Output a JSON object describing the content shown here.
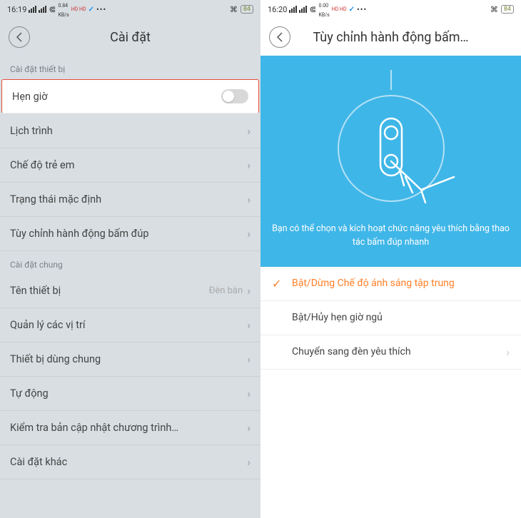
{
  "left": {
    "status": {
      "time": "16:19",
      "speed1": "0.84",
      "speed2": "KB/s",
      "battery": "84"
    },
    "header": {
      "title": "Cài đặt"
    },
    "section1": {
      "label": "Cài đặt thiết bị"
    },
    "rows1": [
      {
        "label": "Hẹn giờ",
        "type": "toggle",
        "highlight": true
      },
      {
        "label": "Lịch trình",
        "type": "chevron"
      },
      {
        "label": "Chế độ trẻ em",
        "type": "chevron"
      },
      {
        "label": "Trạng thái mặc định",
        "type": "chevron"
      },
      {
        "label": "Tùy chỉnh hành động bấm đúp",
        "type": "chevron"
      }
    ],
    "section2": {
      "label": "Cài đặt chung"
    },
    "rows2": [
      {
        "label": "Tên thiết bị",
        "value": "Đèn bàn",
        "type": "chevron"
      },
      {
        "label": "Quản lý các vị trí",
        "type": "chevron"
      },
      {
        "label": "Thiết bị dùng chung",
        "type": "chevron"
      },
      {
        "label": "Tự động",
        "type": "chevron"
      },
      {
        "label": "Kiểm tra bản cập nhật chương trình…",
        "type": "chevron"
      },
      {
        "label": "Cài đặt khác",
        "type": "chevron"
      }
    ]
  },
  "right": {
    "status": {
      "time": "16:20",
      "speed1": "0.00",
      "speed2": "KB/s",
      "battery": "84"
    },
    "header": {
      "title": "Tùy chỉnh hành động bấm…"
    },
    "hero": {
      "text": "Bạn có thể chọn và kích hoạt chức năng yêu thích bằng thao tác bấm đúp nhanh"
    },
    "options": [
      {
        "label": "Bật/Dừng Chế độ ánh sáng tập trung",
        "selected": true,
        "chevron": false
      },
      {
        "label": "Bật/Hủy hẹn giờ ngủ",
        "selected": false,
        "chevron": false
      },
      {
        "label": "Chuyển sang đèn yêu thích",
        "selected": false,
        "chevron": true
      }
    ]
  }
}
